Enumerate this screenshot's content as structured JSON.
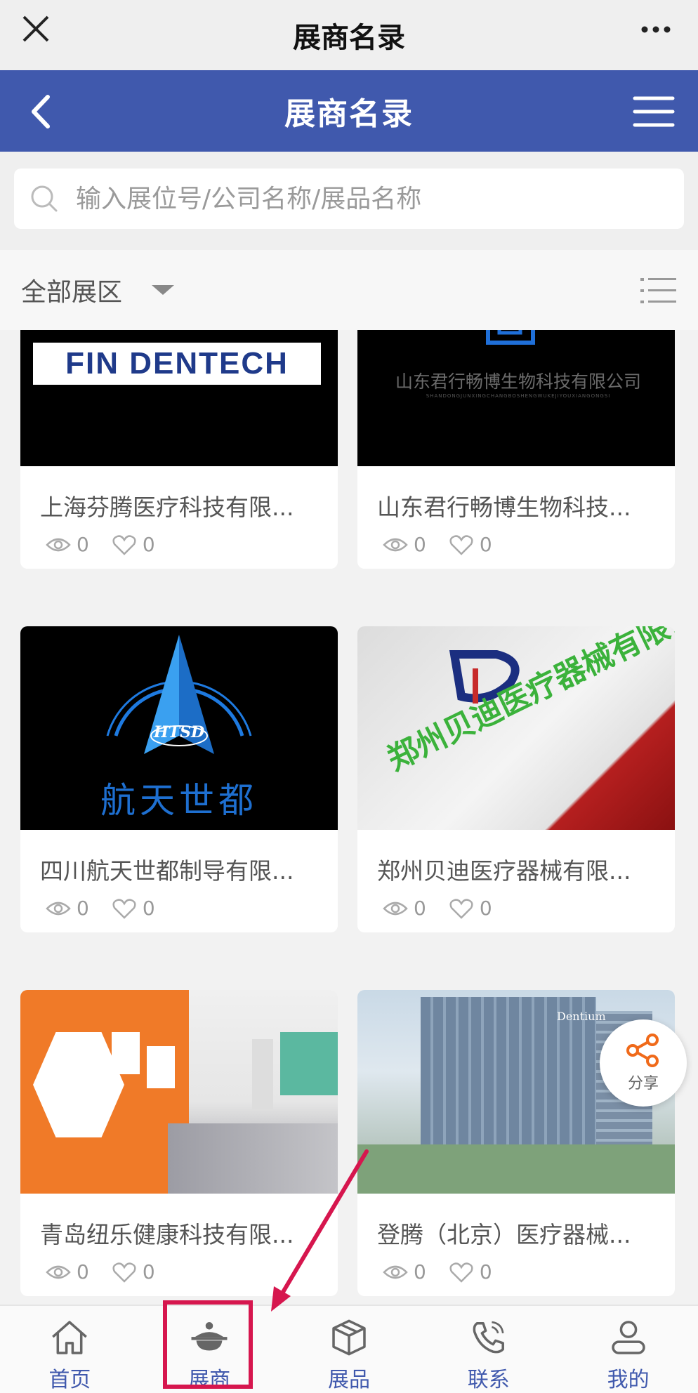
{
  "wechat_bar": {
    "title": "展商名录"
  },
  "header": {
    "title": "展商名录"
  },
  "search": {
    "placeholder": "输入展位号/公司名称/展品名称"
  },
  "filter": {
    "hall_label": "全部展区"
  },
  "exhibitors": [
    {
      "name": "上海芬腾医疗科技有限...",
      "views": "0",
      "likes": "0",
      "logo_text": "FIN DENTECH"
    },
    {
      "name": "山东君行畅博生物科技...",
      "views": "0",
      "likes": "0",
      "logo_text": "山东君行畅博生物科技有限公司",
      "logo_subtext": "SHANDONGJUNXINGCHANGBOSHENGWUKEJIYOUXIANGONGSI"
    },
    {
      "name": "四川航天世都制导有限...",
      "views": "0",
      "likes": "0",
      "logo_text": "航天世都",
      "logo_badge": "HTSD"
    },
    {
      "name": "郑州贝迪医疗器械有限...",
      "views": "0",
      "likes": "0",
      "logo_text": "郑州贝迪医疗器械有限公司"
    },
    {
      "name": "青岛纽乐健康科技有限...",
      "views": "0",
      "likes": "0"
    },
    {
      "name": "登腾（北京）医疗器械...",
      "views": "0",
      "likes": "0",
      "logo_text": "Dentium"
    }
  ],
  "share": {
    "label": "分享"
  },
  "tabs": [
    {
      "label": "首页",
      "icon": "home-icon"
    },
    {
      "label": "展商",
      "icon": "pot-icon"
    },
    {
      "label": "展品",
      "icon": "box-icon"
    },
    {
      "label": "联系",
      "icon": "phone-icon"
    },
    {
      "label": "我的",
      "icon": "user-icon"
    }
  ],
  "colors": {
    "brand": "#4059ad",
    "annotation": "#d6164e"
  }
}
